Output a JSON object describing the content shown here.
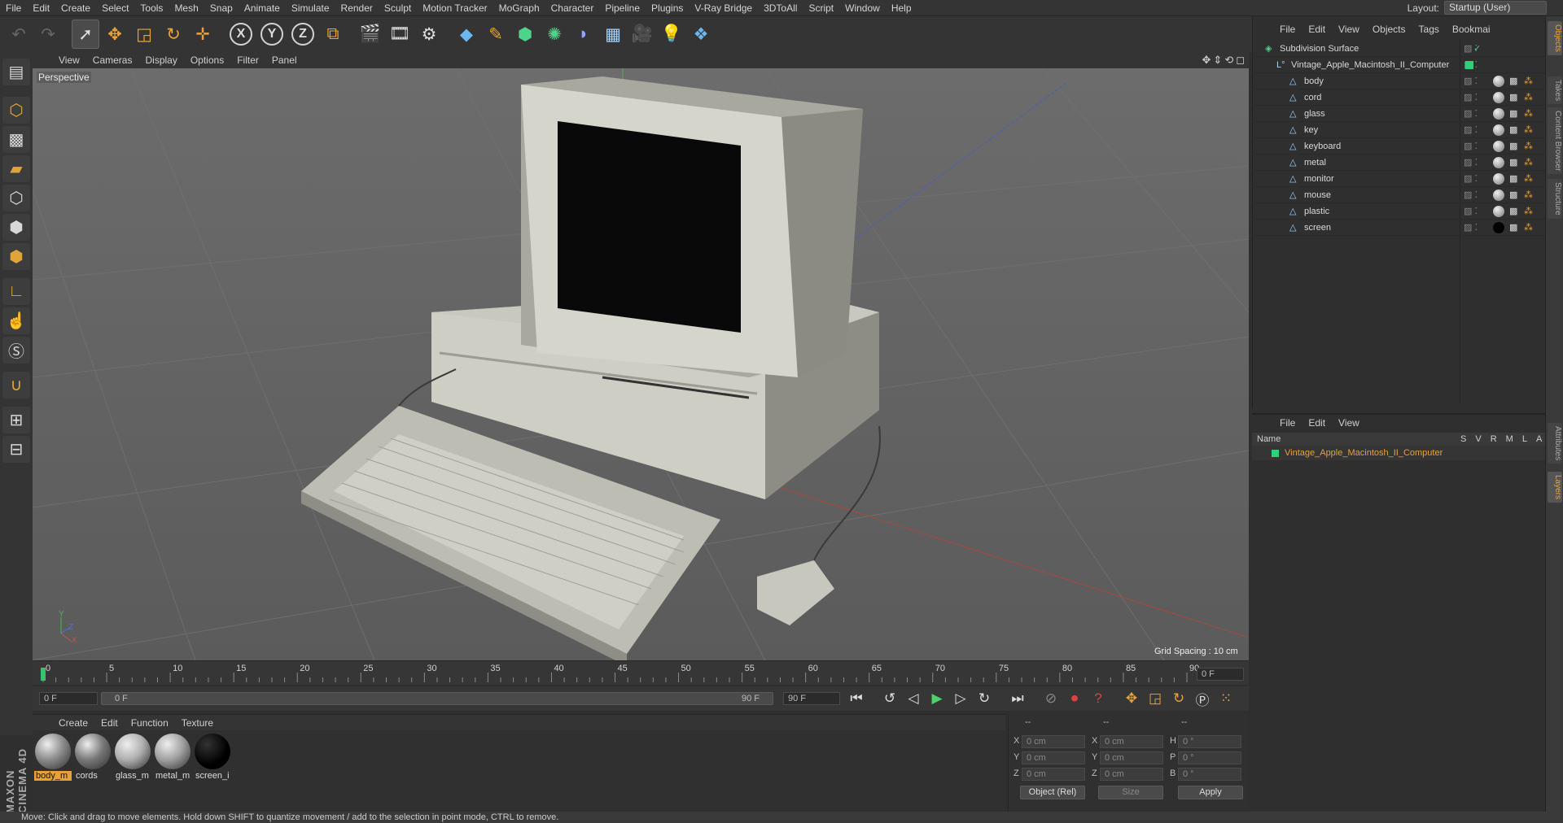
{
  "menu": [
    "File",
    "Edit",
    "Create",
    "Select",
    "Tools",
    "Mesh",
    "Snap",
    "Animate",
    "Simulate",
    "Render",
    "Sculpt",
    "Motion Tracker",
    "MoGraph",
    "Character",
    "Pipeline",
    "Plugins",
    "V-Ray Bridge",
    "3DToAll",
    "Script",
    "Window",
    "Help"
  ],
  "layout": {
    "label": "Layout:",
    "value": "Startup (User)"
  },
  "viewport": {
    "menu": [
      "View",
      "Cameras",
      "Display",
      "Options",
      "Filter",
      "Panel"
    ],
    "label": "Perspective",
    "grid": "Grid Spacing : 10 cm"
  },
  "timeline": {
    "ticks": [
      "0",
      "5",
      "10",
      "15",
      "20",
      "25",
      "30",
      "35",
      "40",
      "45",
      "50",
      "55",
      "60",
      "65",
      "70",
      "75",
      "80",
      "85",
      "90"
    ],
    "frame_right": "0 F",
    "start": "0 F",
    "range_start": "0 F",
    "range_end": "90 F",
    "end": "90 F"
  },
  "materials": {
    "menu": [
      "Create",
      "Edit",
      "Function",
      "Texture"
    ],
    "items": [
      {
        "name": "body_m",
        "color": "#8d8d8d"
      },
      {
        "name": "cords",
        "color": "#7a7a7a"
      },
      {
        "name": "glass_m",
        "color": "#b0b0b0"
      },
      {
        "name": "metal_m",
        "color": "#a2a2a2"
      },
      {
        "name": "screen_i",
        "color": "#0a0a0a"
      }
    ]
  },
  "coords": {
    "headers": [
      "--",
      "--",
      "--"
    ],
    "rows": [
      {
        "a": "X",
        "av": "0 cm",
        "b": "X",
        "bv": "0 cm",
        "c": "H",
        "cv": "0 °"
      },
      {
        "a": "Y",
        "av": "0 cm",
        "b": "Y",
        "bv": "0 cm",
        "c": "P",
        "cv": "0 °"
      },
      {
        "a": "Z",
        "av": "0 cm",
        "b": "Z",
        "bv": "0 cm",
        "c": "B",
        "cv": "0 °"
      }
    ],
    "mode": "Object (Rel)",
    "size": "Size",
    "apply": "Apply"
  },
  "status": "Move: Click and drag to move elements. Hold down SHIFT to quantize movement / add to the selection in point mode, CTRL to remove.",
  "objects": {
    "menu": [
      "File",
      "Edit",
      "View",
      "Objects",
      "Tags",
      "Bookmai"
    ],
    "rows": [
      "Subdivision Surface",
      "Vintage_Apple_Macintosh_II_Computer",
      "body",
      "cord",
      "glass",
      "key",
      "keyboard",
      "metal",
      "monitor",
      "mouse",
      "plastic",
      "screen"
    ]
  },
  "layers": {
    "menu": [
      "File",
      "Edit",
      "View"
    ],
    "name_header": "Name",
    "cols": [
      "S",
      "V",
      "R",
      "M",
      "L",
      "A"
    ],
    "row": "Vintage_Apple_Macintosh_II_Computer"
  },
  "right_tabs": [
    "Objects",
    "Takes",
    "Content Browser",
    "Structure",
    "Attributes",
    "Layers"
  ]
}
